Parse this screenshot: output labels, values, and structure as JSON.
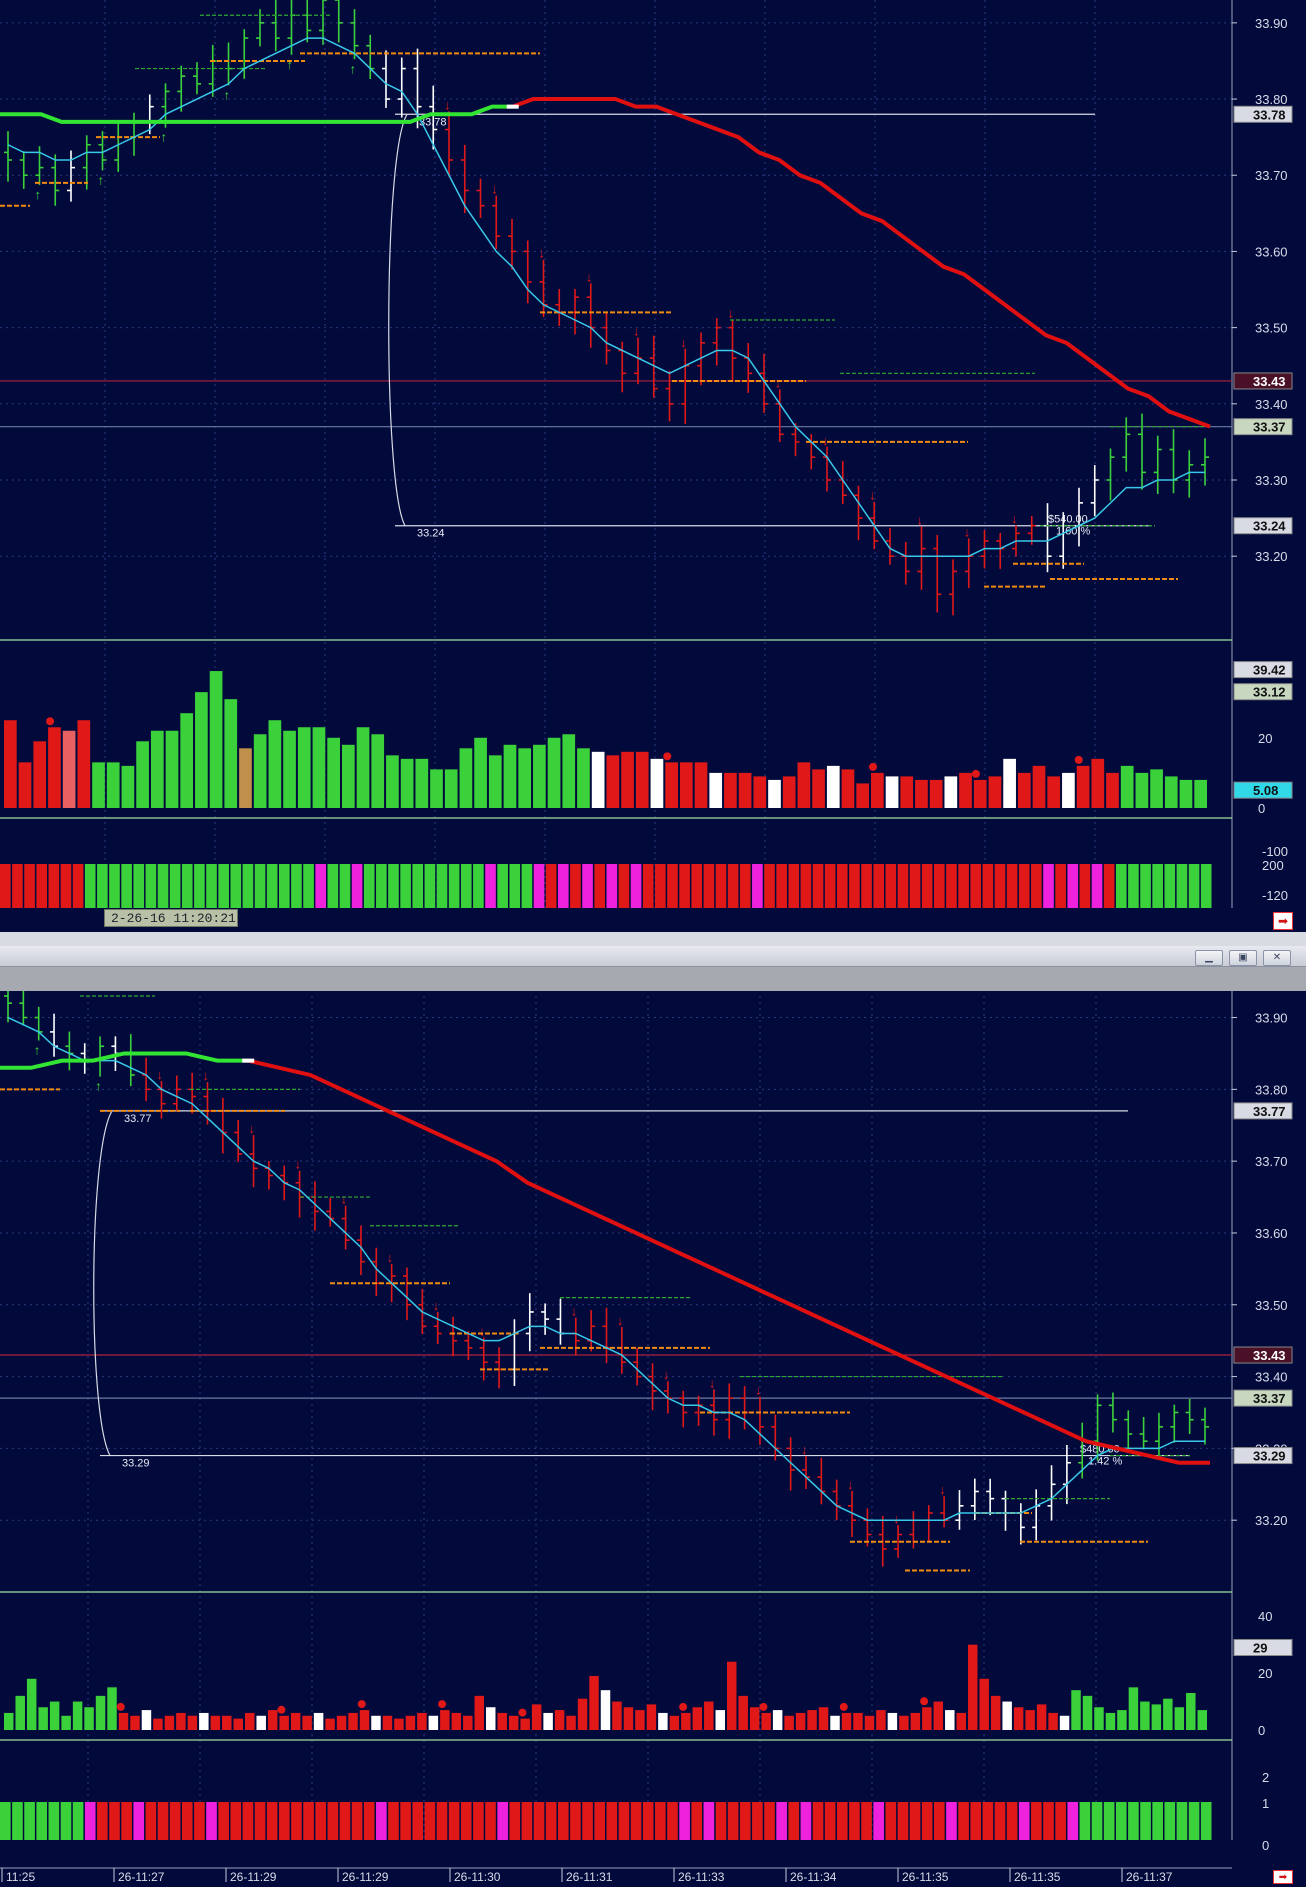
{
  "window": {
    "minimize_icon": "minimize-icon",
    "restore_icon": "restore-icon",
    "close_icon": "close-icon",
    "crosshair_tip": "2-26-16  11:20:21",
    "next_icon": "arrow-right-icon"
  },
  "colors": {
    "background": "#020a3c",
    "up_bar": "#3bd13b",
    "down_bar": "#e01818",
    "neutral_bar": "#ffffff",
    "slow_ma_up": "#33e533",
    "slow_ma_down": "#e01010",
    "fast_ma": "#38c8e8",
    "support_line": "#f08a10",
    "resistance_line": "#2fa82f",
    "tag_highlight": "#4a1028",
    "magenta": "#ee22dd"
  },
  "chart_data": [
    {
      "type": "ohlc",
      "title": "",
      "price_axis": {
        "ylim": [
          33.09,
          33.93
        ],
        "ticks": [
          "33.90",
          "33.80",
          "33.70",
          "33.60",
          "33.50",
          "33.40",
          "33.30",
          "33.20"
        ]
      },
      "price_tags": [
        "33.78",
        "33.43",
        "33.37",
        "33.24"
      ],
      "trade_annotations": {
        "entry_label": "33.78",
        "exit_label": "33.24",
        "profit": "$540.00",
        "percent": "1.60 %"
      },
      "closes": [
        33.72,
        33.7,
        33.71,
        33.68,
        33.71,
        33.74,
        33.72,
        33.75,
        33.77,
        33.79,
        33.81,
        33.83,
        33.82,
        33.85,
        33.84,
        33.88,
        33.9,
        33.88,
        33.91,
        33.89,
        33.93,
        33.9,
        33.87,
        33.84,
        33.8,
        33.84,
        33.79,
        33.76,
        33.72,
        33.68,
        33.66,
        33.62,
        33.6,
        33.56,
        33.53,
        33.52,
        33.54,
        33.5,
        33.47,
        33.44,
        33.46,
        33.42,
        33.4,
        33.45,
        33.48,
        33.5,
        33.46,
        33.44,
        33.4,
        33.36,
        33.35,
        33.33,
        33.3,
        33.28,
        33.25,
        33.22,
        33.2,
        33.18,
        33.21,
        33.15,
        33.18,
        33.2,
        33.22,
        33.21,
        33.23,
        33.24,
        33.2,
        33.24,
        33.27,
        33.3,
        33.33,
        33.36,
        33.31,
        33.34,
        33.3,
        33.32,
        33.33
      ],
      "fast_ma": [
        33.74,
        33.73,
        33.73,
        33.72,
        33.72,
        33.73,
        33.73,
        33.74,
        33.75,
        33.76,
        33.78,
        33.79,
        33.8,
        33.81,
        33.82,
        33.84,
        33.85,
        33.86,
        33.87,
        33.88,
        33.88,
        33.87,
        33.86,
        33.84,
        33.82,
        33.81,
        33.78,
        33.74,
        33.7,
        33.66,
        33.63,
        33.6,
        33.58,
        33.55,
        33.53,
        33.52,
        33.51,
        33.5,
        33.48,
        33.47,
        33.46,
        33.45,
        33.44,
        33.45,
        33.46,
        33.47,
        33.47,
        33.46,
        33.43,
        33.4,
        33.37,
        33.35,
        33.33,
        33.3,
        33.27,
        33.24,
        33.21,
        33.2,
        33.2,
        33.2,
        33.2,
        33.2,
        33.21,
        33.21,
        33.22,
        33.22,
        33.22,
        33.23,
        33.24,
        33.25,
        33.27,
        33.29,
        33.29,
        33.3,
        33.3,
        33.31,
        33.31
      ],
      "slow_ma": [
        33.78,
        33.78,
        33.78,
        33.77,
        33.77,
        33.77,
        33.77,
        33.77,
        33.77,
        33.77,
        33.77,
        33.77,
        33.77,
        33.77,
        33.77,
        33.77,
        33.77,
        33.77,
        33.77,
        33.77,
        33.77,
        33.78,
        33.78,
        33.78,
        33.79,
        33.79,
        33.8,
        33.8,
        33.8,
        33.8,
        33.8,
        33.79,
        33.79,
        33.78,
        33.77,
        33.76,
        33.75,
        33.73,
        33.72,
        33.7,
        33.69,
        33.67,
        33.65,
        33.64,
        33.62,
        33.6,
        33.58,
        33.57,
        33.55,
        33.53,
        33.51,
        33.49,
        33.48,
        33.46,
        33.44,
        33.42,
        33.41,
        33.39,
        33.38,
        33.37
      ],
      "volume": {
        "ylim": [
          0,
          45
        ],
        "ticks": [
          "20",
          "0"
        ],
        "tags": [
          "39.42",
          "33.12",
          "5.08"
        ],
        "values": [
          25,
          13,
          19,
          23,
          22,
          25,
          13,
          13,
          12,
          19,
          22,
          22,
          27,
          33,
          39,
          31,
          17,
          21,
          25,
          22,
          23,
          23,
          20,
          18,
          23,
          21,
          15,
          14,
          14,
          11,
          11,
          17,
          20,
          15,
          18,
          17,
          18,
          20,
          21,
          17,
          16,
          15,
          16,
          16,
          14,
          13,
          13,
          13,
          10,
          10,
          10,
          9,
          8,
          9,
          13,
          11,
          12,
          11,
          7,
          10,
          9,
          9,
          8,
          8,
          9,
          10,
          8,
          9,
          14,
          10,
          12,
          9,
          10,
          12,
          14,
          10,
          12,
          10,
          11,
          9,
          8,
          8
        ]
      },
      "histogram": {
        "ticks": [
          "-100",
          "200",
          "-120"
        ]
      }
    },
    {
      "type": "ohlc",
      "title": "",
      "price_axis": {
        "ylim": [
          33.1,
          33.93
        ],
        "ticks": [
          "33.90",
          "33.80",
          "33.70",
          "33.60",
          "33.50",
          "33.40",
          "33.30",
          "33.20"
        ]
      },
      "price_tags": [
        "33.77",
        "33.43",
        "33.37",
        "33.29"
      ],
      "trade_annotations": {
        "entry_label": "33.77",
        "exit_label": "33.29",
        "profit": "$480.00",
        "percent": "1.42 %"
      },
      "closes": [
        33.92,
        33.9,
        33.88,
        33.86,
        33.85,
        33.84,
        33.86,
        33.85,
        33.82,
        33.8,
        33.78,
        33.8,
        33.79,
        33.77,
        33.74,
        33.71,
        33.69,
        33.68,
        33.67,
        33.65,
        33.63,
        33.62,
        33.59,
        33.56,
        33.53,
        33.54,
        33.5,
        33.47,
        33.46,
        33.45,
        33.44,
        33.42,
        33.41,
        33.46,
        33.49,
        33.48,
        33.46,
        33.45,
        33.47,
        33.44,
        33.42,
        33.4,
        33.38,
        33.37,
        33.35,
        33.36,
        33.34,
        33.37,
        33.35,
        33.33,
        33.3,
        33.27,
        33.26,
        33.24,
        33.22,
        33.2,
        33.18,
        33.16,
        33.18,
        33.2,
        33.21,
        33.2,
        33.22,
        33.24,
        33.23,
        33.21,
        33.19,
        33.22,
        33.25,
        33.28,
        33.31,
        33.36,
        33.34,
        33.32,
        33.31,
        33.33,
        33.35,
        33.34,
        33.33
      ],
      "fast_ma": [
        33.9,
        33.89,
        33.88,
        33.86,
        33.85,
        33.84,
        33.84,
        33.84,
        33.83,
        33.82,
        33.8,
        33.79,
        33.78,
        33.76,
        33.74,
        33.72,
        33.7,
        33.69,
        33.67,
        33.66,
        33.64,
        33.62,
        33.6,
        33.58,
        33.55,
        33.53,
        33.51,
        33.49,
        33.48,
        33.47,
        33.46,
        33.45,
        33.45,
        33.46,
        33.47,
        33.47,
        33.46,
        33.46,
        33.45,
        33.44,
        33.43,
        33.41,
        33.39,
        33.37,
        33.36,
        33.36,
        33.35,
        33.35,
        33.34,
        33.32,
        33.3,
        33.28,
        33.26,
        33.24,
        33.22,
        33.21,
        33.2,
        33.2,
        33.2,
        33.2,
        33.2,
        33.2,
        33.21,
        33.21,
        33.21,
        33.21,
        33.21,
        33.22,
        33.23,
        33.25,
        33.27,
        33.29,
        33.3,
        33.3,
        33.3,
        33.3,
        33.31,
        33.31,
        33.31
      ],
      "slow_ma": [
        33.83,
        33.83,
        33.84,
        33.84,
        33.85,
        33.85,
        33.85,
        33.84,
        33.84,
        33.83,
        33.82,
        33.8,
        33.78,
        33.76,
        33.74,
        33.72,
        33.7,
        33.67,
        33.65,
        33.63,
        33.61,
        33.59,
        33.57,
        33.55,
        33.53,
        33.51,
        33.49,
        33.47,
        33.45,
        33.43,
        33.41,
        33.39,
        33.37,
        33.35,
        33.33,
        33.31,
        33.3,
        33.29,
        33.28,
        33.28
      ],
      "volume": {
        "ylim": [
          0,
          45
        ],
        "ticks": [
          "40",
          "20",
          "0"
        ],
        "tags": [
          "29"
        ],
        "values": [
          6,
          12,
          18,
          8,
          10,
          5,
          10,
          8,
          12,
          15,
          6,
          5,
          7,
          4,
          5,
          6,
          5,
          6,
          5,
          5,
          4,
          6,
          5,
          7,
          5,
          6,
          5,
          6,
          4,
          5,
          6,
          7,
          5,
          5,
          4,
          5,
          6,
          5,
          7,
          6,
          5,
          12,
          8,
          6,
          5,
          4,
          9,
          6,
          7,
          5,
          11,
          19,
          14,
          10,
          8,
          7,
          9,
          6,
          5,
          6,
          8,
          10,
          7,
          24,
          12,
          8,
          6,
          7,
          5,
          6,
          7,
          8,
          5,
          6,
          6,
          5,
          7,
          6,
          5,
          6,
          8,
          10,
          7,
          6,
          30,
          18,
          12,
          10,
          8,
          7,
          9,
          6,
          5,
          14,
          12,
          8,
          6,
          7,
          15,
          10,
          9,
          11,
          8,
          13,
          7
        ]
      },
      "histogram": {
        "ticks": [
          "2",
          "1",
          "0"
        ]
      }
    }
  ],
  "time_axis": {
    "labels": [
      "11:25",
      "26-11:27",
      "26-11:29",
      "26-11:29",
      "26-11:30",
      "26-11:31",
      "26-11:33",
      "26-11:34",
      "26-11:35",
      "26-11:35",
      "26-11:37"
    ]
  }
}
